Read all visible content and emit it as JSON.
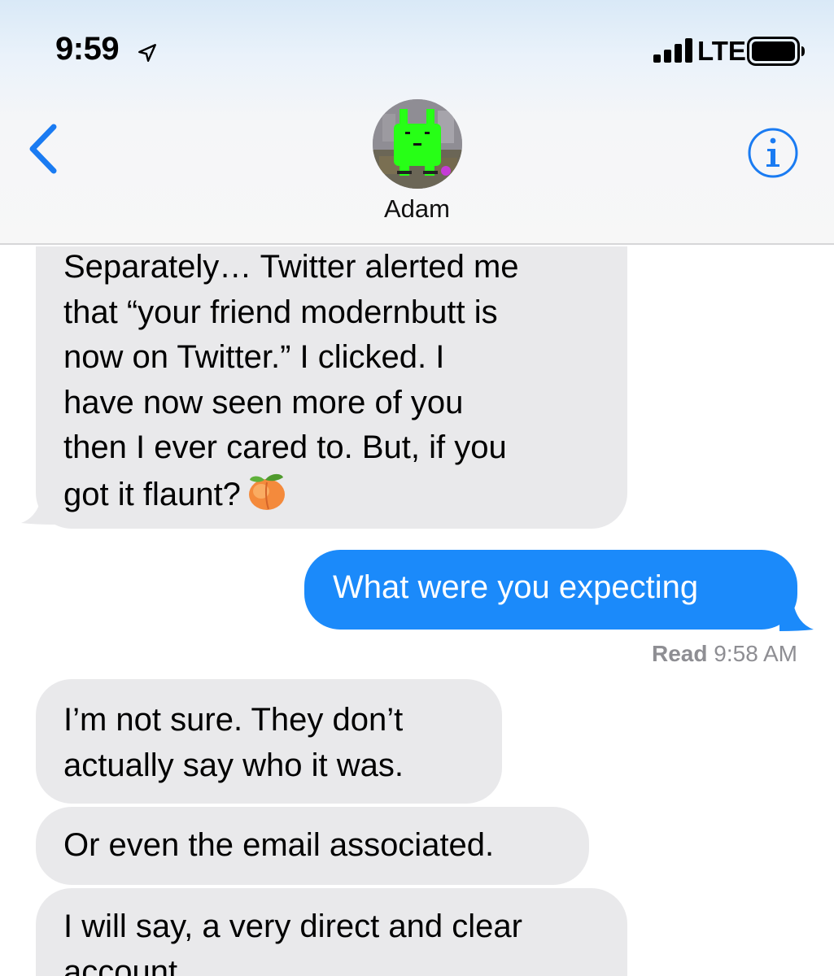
{
  "status_bar": {
    "time": "9:59",
    "location_icon": "location-arrow-icon",
    "signal_icon": "cellular-signal-icon",
    "network": "LTE",
    "battery_icon": "battery-icon"
  },
  "nav": {
    "back_icon": "chevron-left-icon",
    "contact_name": "Adam",
    "avatar": "contact-avatar",
    "info_icon": "info-icon"
  },
  "messages": [
    {
      "direction": "received",
      "text": "Separately… Twitter alerted me\nthat “your friend modernbutt is\nnow on Twitter.” I clicked. I\nhave now seen more of you\nthen I ever cared to. But, if you\ngot it flaunt?",
      "emoji": "peach-icon"
    },
    {
      "direction": "sent",
      "text": "What were you expecting"
    },
    {
      "direction": "received",
      "text": "I’m not sure. They don’t\nactually say who it was."
    },
    {
      "direction": "received",
      "text": "Or even the email associated."
    },
    {
      "direction": "received",
      "text": "I will say, a very direct and clear\naccount."
    }
  ],
  "read_receipt": {
    "label": "Read",
    "time": "9:58 AM"
  },
  "colors": {
    "sent_bubble": "#1b8afa",
    "received_bubble": "#e9e9eb",
    "accent": "#1a7bf2",
    "receipt_text": "#8e8e93"
  }
}
